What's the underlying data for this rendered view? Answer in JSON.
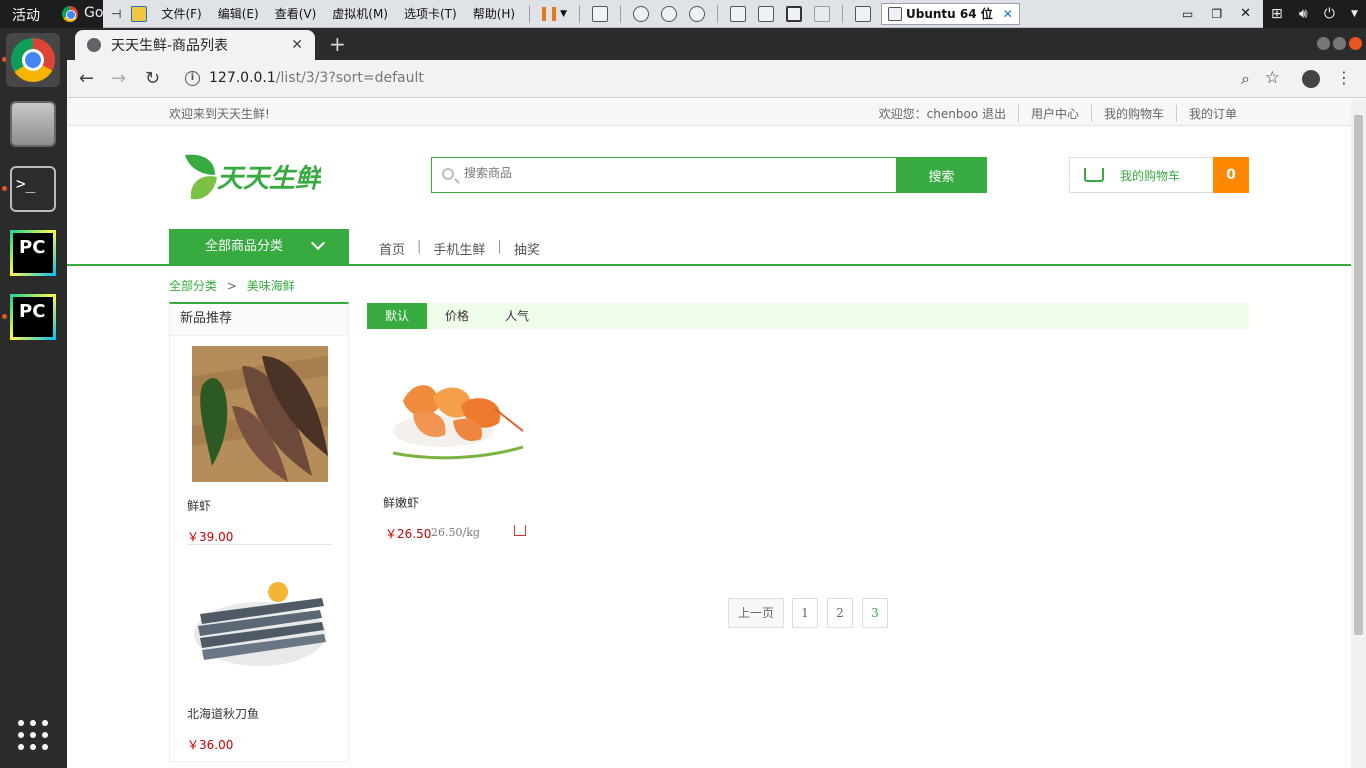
{
  "os": {
    "activities": "活动",
    "chrome_tab_stub": "Go"
  },
  "vmware": {
    "menus": [
      "文件(F)",
      "编辑(E)",
      "查看(V)",
      "虚拟机(M)",
      "选项卡(T)",
      "帮助(H)"
    ],
    "tab_label": "Ubuntu 64 位"
  },
  "browser": {
    "tab_title": "天天生鲜-商品列表",
    "url_host": "127.0.0.1",
    "url_path": "/list/3/3?sort=default"
  },
  "site": {
    "welcome": "欢迎来到天天生鲜!",
    "user_links": [
      "欢迎您：chenboo 退出",
      "用户中心",
      "我的购物车",
      "我的订单"
    ],
    "logo_text": "天天生鲜",
    "search": {
      "placeholder": "搜索商品",
      "button": "搜索"
    },
    "cart": {
      "label": "我的购物车",
      "count": "0"
    },
    "nav": {
      "all_categories": "全部商品分类",
      "links": [
        "首页",
        "手机生鲜",
        "抽奖"
      ]
    },
    "breadcrumb": {
      "root": "全部分类",
      "arrow": ">",
      "current": "美味海鲜"
    },
    "sidebar": {
      "title": "新品推荐",
      "items": [
        {
          "name": "鲜虾",
          "price": "￥39.00"
        },
        {
          "name": "北海道秋刀鱼",
          "price": "￥36.00"
        }
      ]
    },
    "sort_tabs": [
      "默认",
      "价格",
      "人气"
    ],
    "product": {
      "name": "鲜嫩虾",
      "price": "￥26.50",
      "unit_price": "26.50/kg"
    },
    "pager": {
      "prev": "上一页",
      "pages": [
        "1",
        "2",
        "3"
      ],
      "current": "3"
    }
  },
  "colors": {
    "brand_green": "#37ab40",
    "cart_orange": "#ff8800",
    "price_red": "#c40000"
  }
}
